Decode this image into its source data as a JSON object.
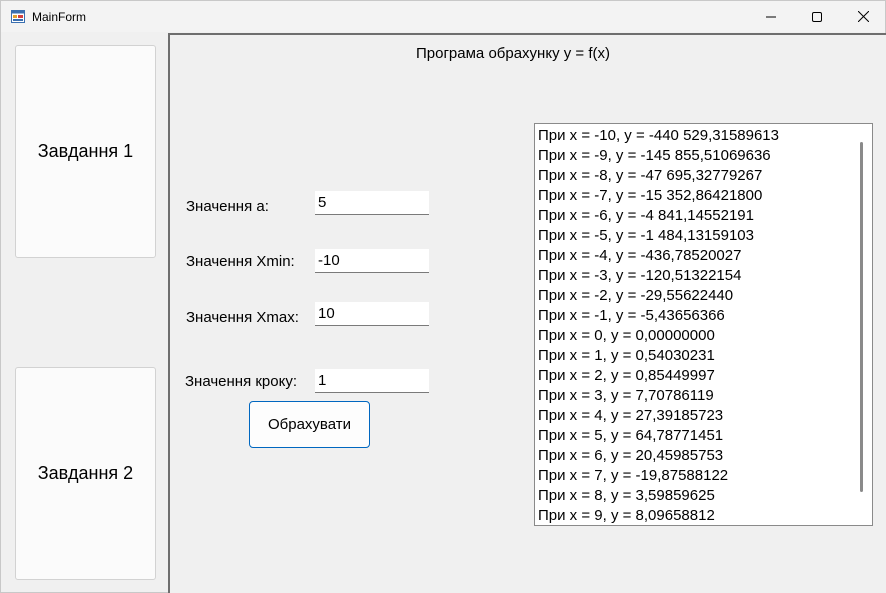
{
  "window": {
    "title": "MainForm",
    "controls": {
      "minimize_icon": "minimize-icon",
      "maximize_icon": "maximize-icon",
      "close_icon": "close-icon"
    }
  },
  "sidebar": {
    "task1_label": "Завдання 1",
    "task2_label": "Завдання 2"
  },
  "main": {
    "heading": "Програма обрахунку y = f(x)",
    "fields": {
      "a": {
        "label": "Значення а:",
        "value": "5"
      },
      "xmin": {
        "label": "Значення Xmin:",
        "value": "-10"
      },
      "xmax": {
        "label": "Значення Xmax:",
        "value": "10"
      },
      "step": {
        "label": "Значення кроку:",
        "value": "1"
      }
    },
    "calculate_label": "Обрахувати",
    "results": [
      "При x = -10, y = -440 529,31589613",
      "При x = -9, y = -145 855,51069636",
      "При x = -8, y = -47 695,32779267",
      "При x = -7, y = -15 352,86421800",
      "При x = -6, y = -4 841,14552191",
      "При x = -5, y = -1 484,13159103",
      "При x = -4, y = -436,78520027",
      "При x = -3, y = -120,51322154",
      "При x = -2, y = -29,55622440",
      "При x = -1, y = -5,43656366",
      "При x = 0, y = 0,00000000",
      "При x = 1, y = 0,54030231",
      "При x = 2, y = 0,85449997",
      "При x = 3, y = 7,70786119",
      "При x = 4, y = 27,39185723",
      "При x = 5, y = 64,78771451",
      "При x = 6, y = 20,45985753",
      "При x = 7, y = -19,87588122",
      "При x = 8, y = 3,59859625",
      "При x = 9, y = 8,09658812"
    ]
  }
}
